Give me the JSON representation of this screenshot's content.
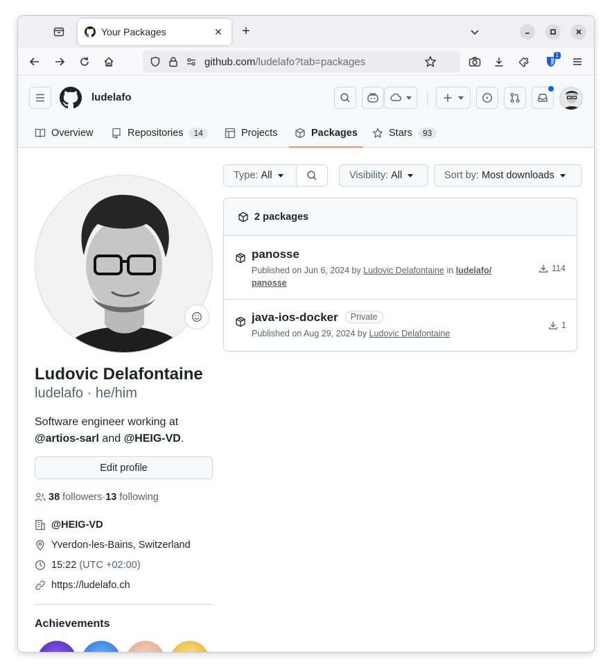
{
  "browser": {
    "tab_title": "Your Packages",
    "url_host": "github.com",
    "url_path": "/ludelafo?tab=packages",
    "extension_badge": "1"
  },
  "header": {
    "username": "ludelafo",
    "tabs": [
      {
        "label": "Overview"
      },
      {
        "label": "Repositories",
        "count": "14"
      },
      {
        "label": "Projects"
      },
      {
        "label": "Packages"
      },
      {
        "label": "Stars",
        "count": "93"
      }
    ]
  },
  "profile": {
    "name": "Ludovic Delafontaine",
    "login_pronouns": "ludelafo · he/him",
    "bio_prefix": "Software engineer working at",
    "bio_org1": "@artios-sarl",
    "bio_and": " and ",
    "bio_org2": "@HEIG-VD",
    "bio_suffix": ".",
    "edit_label": "Edit profile",
    "followers_count": "38",
    "followers_label": "followers",
    "following_sep": " · ",
    "following_count": "13",
    "following_label": "following",
    "org": "@HEIG-VD",
    "location": "Yverdon-les-Bains, Switzerland",
    "time": "15:22",
    "timezone": "(UTC +02:00)",
    "website": "https://ludelafo.ch",
    "achievements_title": "Achievements"
  },
  "filters": {
    "type_label": "Type:",
    "type_value": "All",
    "visibility_label": "Visibility:",
    "visibility_value": "All",
    "sort_label": "Sort by:",
    "sort_value": "Most downloads"
  },
  "packages": {
    "count_label": "2 packages",
    "items": [
      {
        "name": "panosse",
        "published": "Published on Jun 6, 2024 by",
        "author": "Ludovic Delafontaine",
        "in": "in",
        "repo_owner": "ludelafo/",
        "repo_name": "panosse",
        "downloads": "114"
      },
      {
        "name": "java-ios-docker",
        "visibility": "Private",
        "published": "Published on Aug 29, 2024 by",
        "author": "Ludovic Delafontaine",
        "downloads": "1"
      }
    ]
  },
  "colors": {
    "accent_underline": "#fd8c73",
    "link": "#0969da",
    "border": "#d0d7de"
  }
}
